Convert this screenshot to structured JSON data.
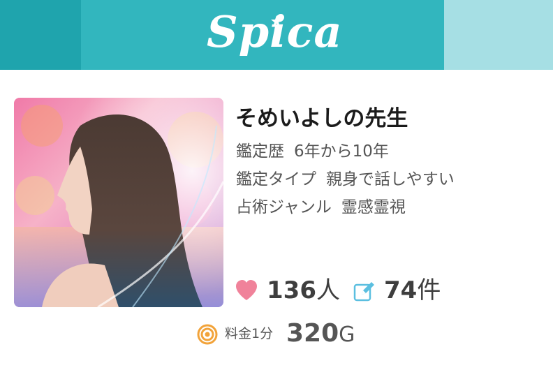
{
  "header": {
    "logo_text": "Spica",
    "colors": {
      "left": "#1fa4ad",
      "center": "#32b6be",
      "right": "#a6dfe4"
    }
  },
  "profile": {
    "photo": "fortune-teller-portrait",
    "name": "そめいよしの先生",
    "career": {
      "label": "鑑定歴",
      "value": "6年から10年"
    },
    "type": {
      "label": "鑑定タイプ",
      "value": "親身で話しやすい"
    },
    "genre": {
      "label": "占術ジャンル",
      "value": "霊感霊視"
    }
  },
  "stats": {
    "likes_icon": "heart-icon",
    "likes_count": "136",
    "likes_unit": "人",
    "reviews_icon": "pencil-icon",
    "reviews_count": "74",
    "reviews_unit": "件"
  },
  "price": {
    "icon": "coin-icon",
    "label": "料金1分",
    "amount": "320",
    "unit": "G"
  },
  "colors": {
    "heart": "#f0829a",
    "pencil": "#5bbfe0",
    "coin": "#f2a33a"
  }
}
